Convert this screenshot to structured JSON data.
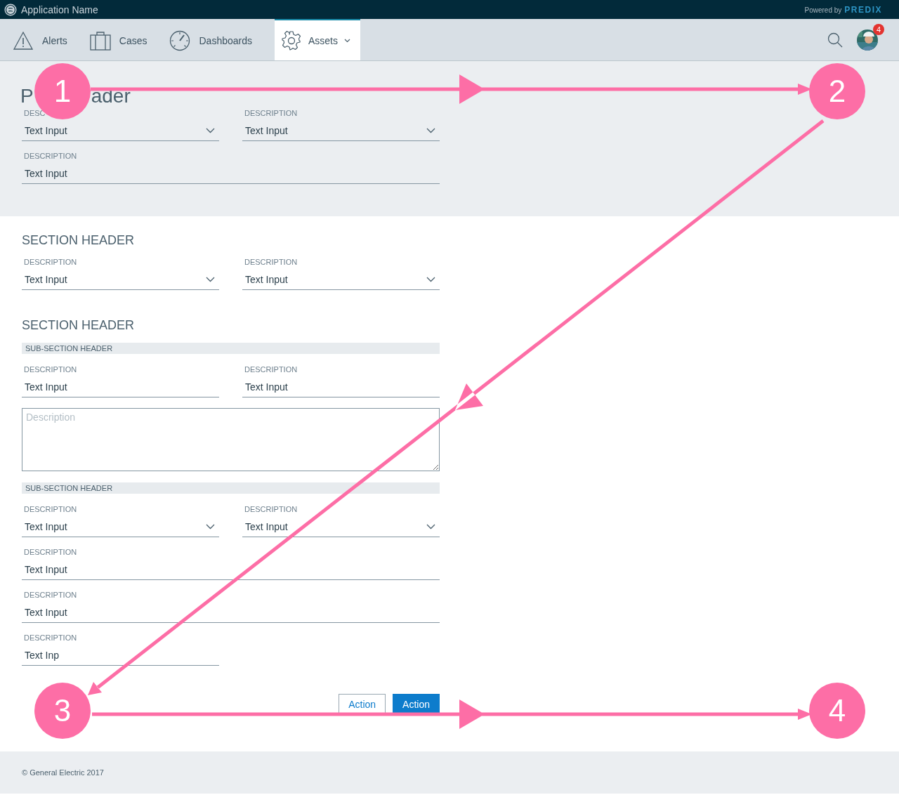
{
  "app": {
    "title": "Application Name",
    "powered_by": "Powered by",
    "brand": "PREDIX"
  },
  "nav": {
    "items": [
      {
        "label": "Alerts",
        "kind": "alert",
        "selected": false,
        "dropdown": false
      },
      {
        "label": "Cases",
        "kind": "case",
        "selected": false,
        "dropdown": false
      },
      {
        "label": "Dashboards",
        "kind": "gauge",
        "selected": false,
        "dropdown": false
      },
      {
        "label": "Assets",
        "kind": "gear",
        "selected": true,
        "dropdown": true
      }
    ],
    "notification_count": "4"
  },
  "page_header": {
    "visible_start": "P",
    "visible_end": "ader"
  },
  "top_rows": [
    [
      {
        "kind": "select",
        "wide": false,
        "label": "DESC",
        "value": "Text Input"
      },
      {
        "kind": "select",
        "wide": false,
        "label": "DESCRIPTION",
        "value": "Text Input"
      }
    ],
    [
      {
        "kind": "text",
        "wide": true,
        "label": "DESCRIPTION",
        "value": "Text Input"
      }
    ]
  ],
  "sections": [
    {
      "title": "SECTION HEADER",
      "groups": [
        {
          "rows": [
            [
              {
                "kind": "select",
                "wide": false,
                "label": "DESCRIPTION",
                "value": "Text Input"
              },
              {
                "kind": "select",
                "wide": false,
                "label": "DESCRIPTION",
                "value": "Text Input"
              }
            ]
          ]
        }
      ]
    },
    {
      "title": "SECTION HEADER",
      "groups": [
        {
          "subheader": "SUB-SECTION HEADER",
          "rows": [
            [
              {
                "kind": "text",
                "wide": false,
                "label": "DESCRIPTION",
                "value": "Text Input"
              },
              {
                "kind": "text",
                "wide": false,
                "label": "DESCRIPTION",
                "value": "Text Input"
              }
            ],
            [
              {
                "kind": "textarea",
                "placeholder": "Description"
              }
            ]
          ]
        },
        {
          "subheader": "SUB-SECTION HEADER",
          "rows": [
            [
              {
                "kind": "select",
                "wide": false,
                "label": "DESCRIPTION",
                "value": "Text Input"
              },
              {
                "kind": "select",
                "wide": false,
                "label": "DESCRIPTION",
                "value": "Text Input"
              }
            ],
            [
              {
                "kind": "text",
                "wide": true,
                "label": "DESCRIPTION",
                "value": "Text Input"
              }
            ],
            [
              {
                "kind": "text",
                "wide": true,
                "label": "DESCRIPTION",
                "value": "Text Input"
              }
            ],
            [
              {
                "kind": "text",
                "wide": false,
                "label": "DESCRIPTION",
                "value": "Text Inp"
              }
            ]
          ]
        }
      ]
    }
  ],
  "buttons": [
    {
      "label": "Action",
      "kind": "secondary"
    },
    {
      "label": "Action",
      "kind": "primary"
    }
  ],
  "footer": "© General Electric 2017",
  "annotations": [
    {
      "label": "1"
    },
    {
      "label": "2"
    },
    {
      "label": "3"
    },
    {
      "label": "4"
    }
  ]
}
